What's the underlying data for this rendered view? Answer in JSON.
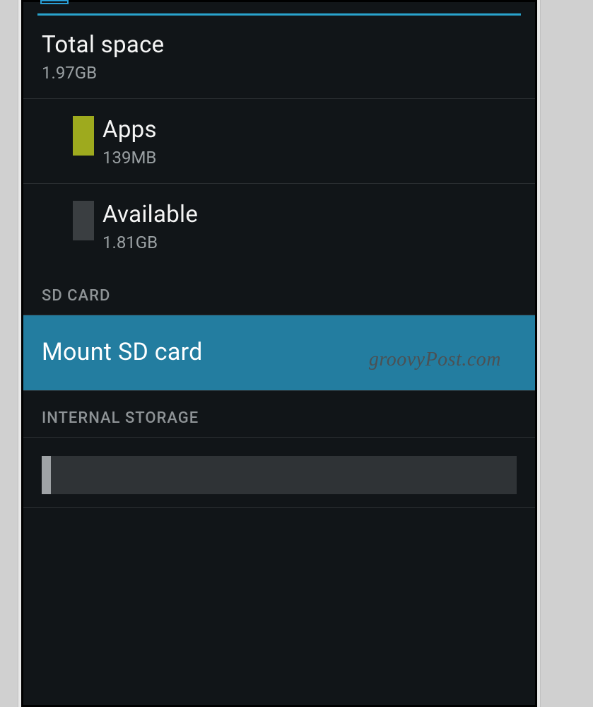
{
  "storage": {
    "total_space": {
      "label": "Total space",
      "value": "1.97GB"
    },
    "apps": {
      "label": "Apps",
      "value": "139MB",
      "swatch_color": "#9eaa1e"
    },
    "available": {
      "label": "Available",
      "value": "1.81GB",
      "swatch_color": "#3a3e41"
    }
  },
  "sections": {
    "sd_card": "SD CARD",
    "internal_storage": "INTERNAL STORAGE"
  },
  "actions": {
    "mount_sd": "Mount SD card"
  },
  "watermark": "groovyPost.com"
}
